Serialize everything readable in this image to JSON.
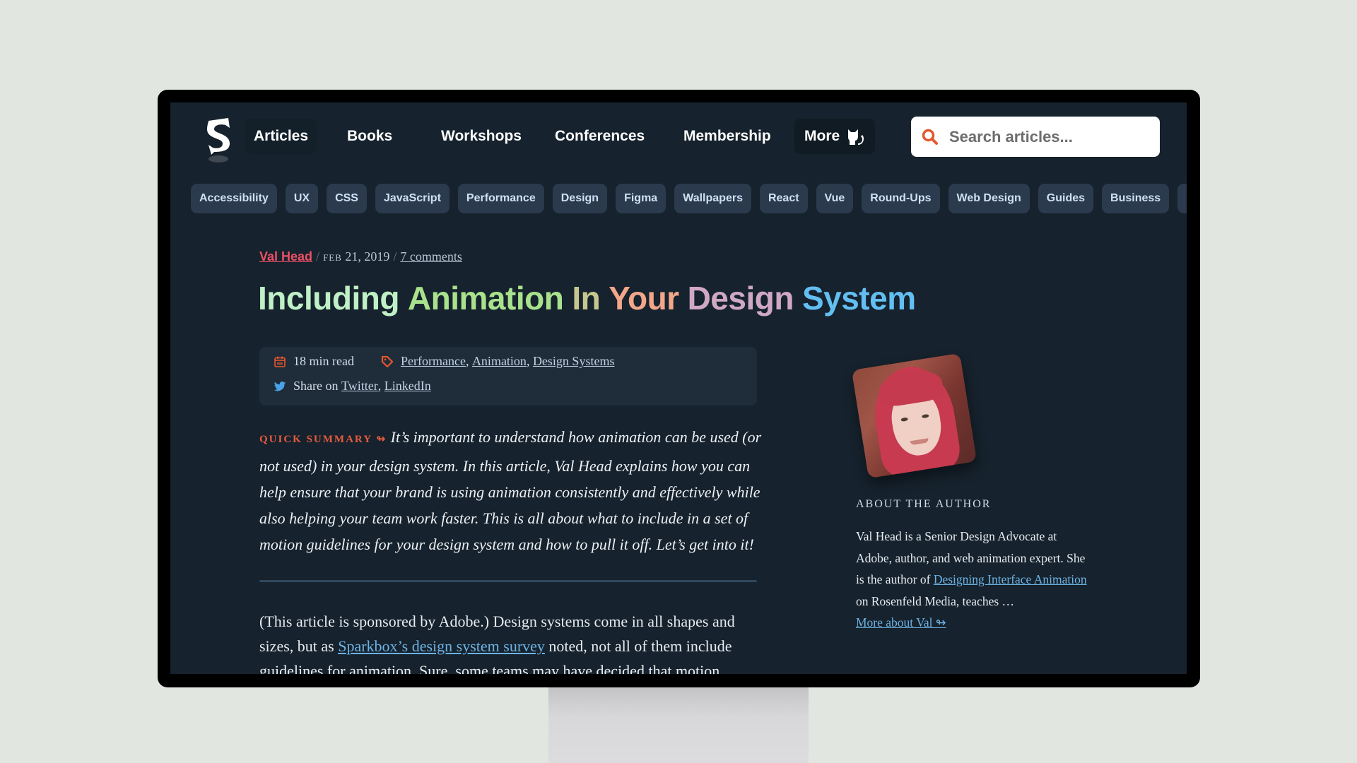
{
  "nav": {
    "logo_alt": "Smashing Magazine",
    "items": [
      {
        "label": "Articles",
        "active": true
      },
      {
        "label": "Books"
      },
      {
        "label": "Workshops"
      },
      {
        "label": "Conferences"
      },
      {
        "label": "Membership"
      },
      {
        "label": "More",
        "icon": "cat-icon"
      }
    ],
    "search": {
      "placeholder": "Search articles...",
      "icon": "search-icon"
    }
  },
  "tags": [
    "Accessibility",
    "UX",
    "CSS",
    "JavaScript",
    "Performance",
    "Design",
    "Figma",
    "Wallpapers",
    "React",
    "Vue",
    "Round-Ups",
    "Web Design",
    "Guides",
    "Business",
    ""
  ],
  "article": {
    "author": "Val Head",
    "date_month": "FEB",
    "date_rest": "21, 2019",
    "comments": "7 comments",
    "title_words": [
      {
        "text": "Including",
        "color": "#bff0c6"
      },
      {
        "text": "Animation",
        "color": "#a9e28c"
      },
      {
        "text": "In",
        "color": "#c6c78e"
      },
      {
        "text": "Your",
        "color": "#f2a68a"
      },
      {
        "text": "Design",
        "color": "#cfa8c4"
      },
      {
        "text": "System",
        "color": "#63bff2"
      }
    ],
    "read_time": "18 min read",
    "categories": [
      "Performance",
      "Animation",
      "Design Systems"
    ],
    "share_label": "Share on",
    "share_links": [
      "Twitter",
      "LinkedIn"
    ],
    "summary_label": "QUICK SUMMARY",
    "summary_arrow": "↬",
    "summary_text": "It’s important to understand how animation can be used (or not used) in your design system. In this article, Val Head explains how you can help ensure that your brand is using animation consistently and effectively while also helping your team work faster. This is all about what to include in a set of motion guidelines for your design system and how to pull it off. Let’s get into it!",
    "body_intro": "(This article is sponsored by Adobe.) Design systems come in all shapes and sizes, but as ",
    "body_link": "Sparkbox’s design system survey",
    "body_rest": " noted, not all of them include guidelines for animation. Sure, some teams may have decided that motion"
  },
  "author_box": {
    "label": "ABOUT THE AUTHOR",
    "bio_start": "Val Head is a Senior Design Advocate at Adobe, author, and web animation expert. She is the author of ",
    "book_link": "Designing Interface Animation",
    "bio_end": " on Rosenfeld Media, teaches …",
    "more_link": "More about Val ↬"
  },
  "colors": {
    "accent_red": "#e55b3f",
    "author_red": "#ec5166",
    "link_blue": "#6db3e4",
    "twitter_blue": "#4aa3e8",
    "background": "#16222d"
  }
}
